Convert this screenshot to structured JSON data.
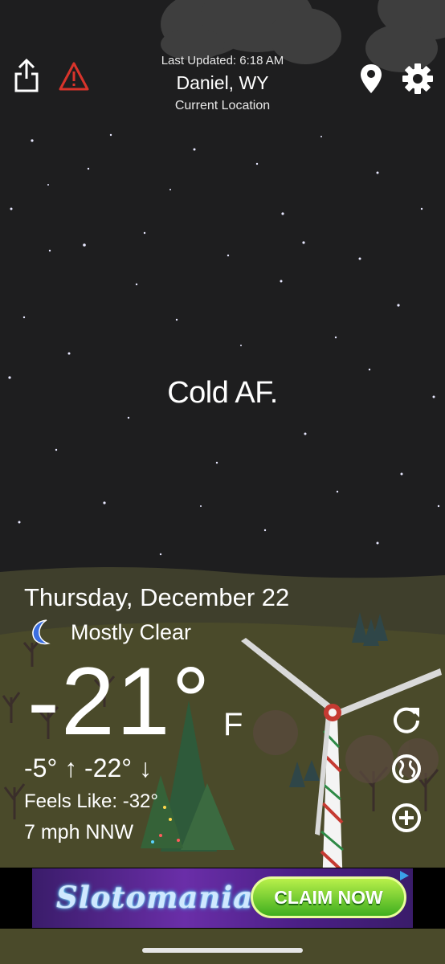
{
  "header": {
    "last_updated": "Last Updated: 6:18 AM",
    "city": "Daniel, WY",
    "location_label": "Current Location",
    "icons": [
      "share-icon",
      "alert-icon",
      "location-pin-icon",
      "gear-icon"
    ]
  },
  "tagline": "Cold AF.",
  "weather": {
    "date": "Thursday, December 22",
    "condition": "Mostly Clear",
    "condition_icon": "moon-icon",
    "temperature": "-21°",
    "unit": "F",
    "high_low": "-5° ↑  -22° ↓",
    "feels_like": "Feels Like: -32°",
    "wind": "7 mph NNW"
  },
  "side_buttons": [
    "refresh-icon",
    "radar-icon",
    "add-location-icon"
  ],
  "ad": {
    "brand": "Slotomania",
    "button_label": "CLAIM NOW"
  },
  "colors": {
    "sky": "#1e1e1f",
    "hill": "#4a4a2a",
    "alert_red": "#d9342b",
    "moon_blue": "#3b6fe0"
  }
}
